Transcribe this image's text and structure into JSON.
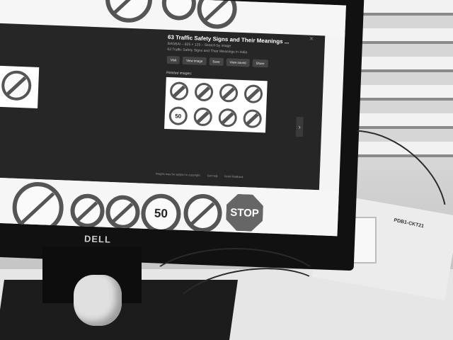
{
  "monitor": {
    "brand": "DELL"
  },
  "image_detail": {
    "title": "63 Traffic Safety Signs and Their Meanings ...",
    "subtitle": "BAGBAI – 825 × 125 – Search by image",
    "description": "63 Traffic Safety Signs and Their Meanings in India",
    "buttons": [
      "Visit",
      "View image",
      "Save",
      "View saved",
      "Share"
    ],
    "related_label": "Related images:",
    "footer": {
      "copyright": "Images may be subject to copyright.",
      "help": "Get help",
      "feedback": "Send feedback"
    },
    "close_glyph": "×",
    "next_glyph": "›"
  },
  "signs": {
    "speed_limit": "50",
    "stop": "STOP",
    "thumb_speed": "50"
  },
  "socket_panel": {
    "label": "PDB1-CKT21"
  }
}
